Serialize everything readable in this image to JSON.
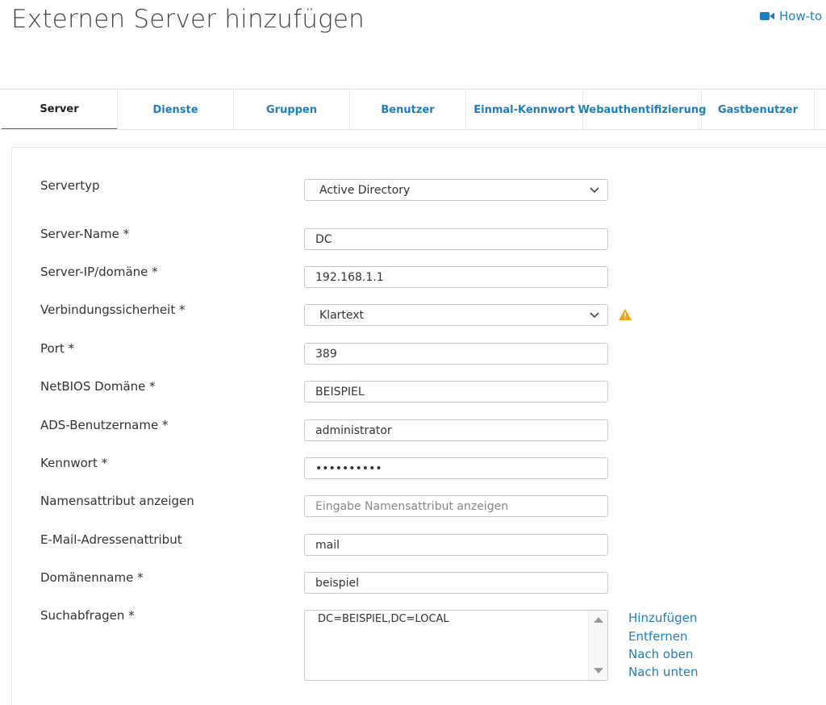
{
  "page": {
    "title": "Externen Server hinzufügen"
  },
  "howto": {
    "label": "How-to",
    "icon": "video-camera-icon",
    "color": "#1a7fc4"
  },
  "tabs": [
    {
      "label": "Server",
      "active": true
    },
    {
      "label": "Dienste"
    },
    {
      "label": "Gruppen"
    },
    {
      "label": "Benutzer"
    },
    {
      "label": "Einmal-Kennwort"
    },
    {
      "label": "Webauthentifizierung"
    },
    {
      "label": "Gastbenutzer"
    }
  ],
  "form": {
    "server_type": {
      "label": "Servertyp",
      "value": "Active Directory"
    },
    "server_name": {
      "label": "Server-Name *",
      "value": "DC"
    },
    "server_ip": {
      "label": "Server-IP/domäne *",
      "value": "192.168.1.1"
    },
    "connection_security": {
      "label": "Verbindungssicherheit *",
      "value": "Klartext",
      "warning_icon": "warning-triangle-icon",
      "warning_color": "#f0a30a"
    },
    "port": {
      "label": "Port *",
      "value": "389"
    },
    "netbios_domain": {
      "label": "NetBIOS Domäne *",
      "value": "BEISPIEL"
    },
    "ads_username": {
      "label": "ADS-Benutzername *",
      "value": "administrator"
    },
    "password": {
      "label": "Kennwort *",
      "value": "••••••••••"
    },
    "display_name_attr": {
      "label": "Namensattribut anzeigen",
      "value": "",
      "placeholder": "Eingabe Namensattribut anzeigen"
    },
    "email_attr": {
      "label": "E-Mail-Adressenattribut",
      "value": "mail"
    },
    "domain_name": {
      "label": "Domänenname *",
      "value": "beispiel"
    },
    "search_queries": {
      "label": "Suchabfragen *",
      "items": [
        "DC=BEISPIEL,DC=LOCAL"
      ],
      "actions": {
        "add": "Hinzufügen",
        "remove": "Entfernen",
        "move_up": "Nach oben",
        "move_down": "Nach unten"
      }
    }
  }
}
